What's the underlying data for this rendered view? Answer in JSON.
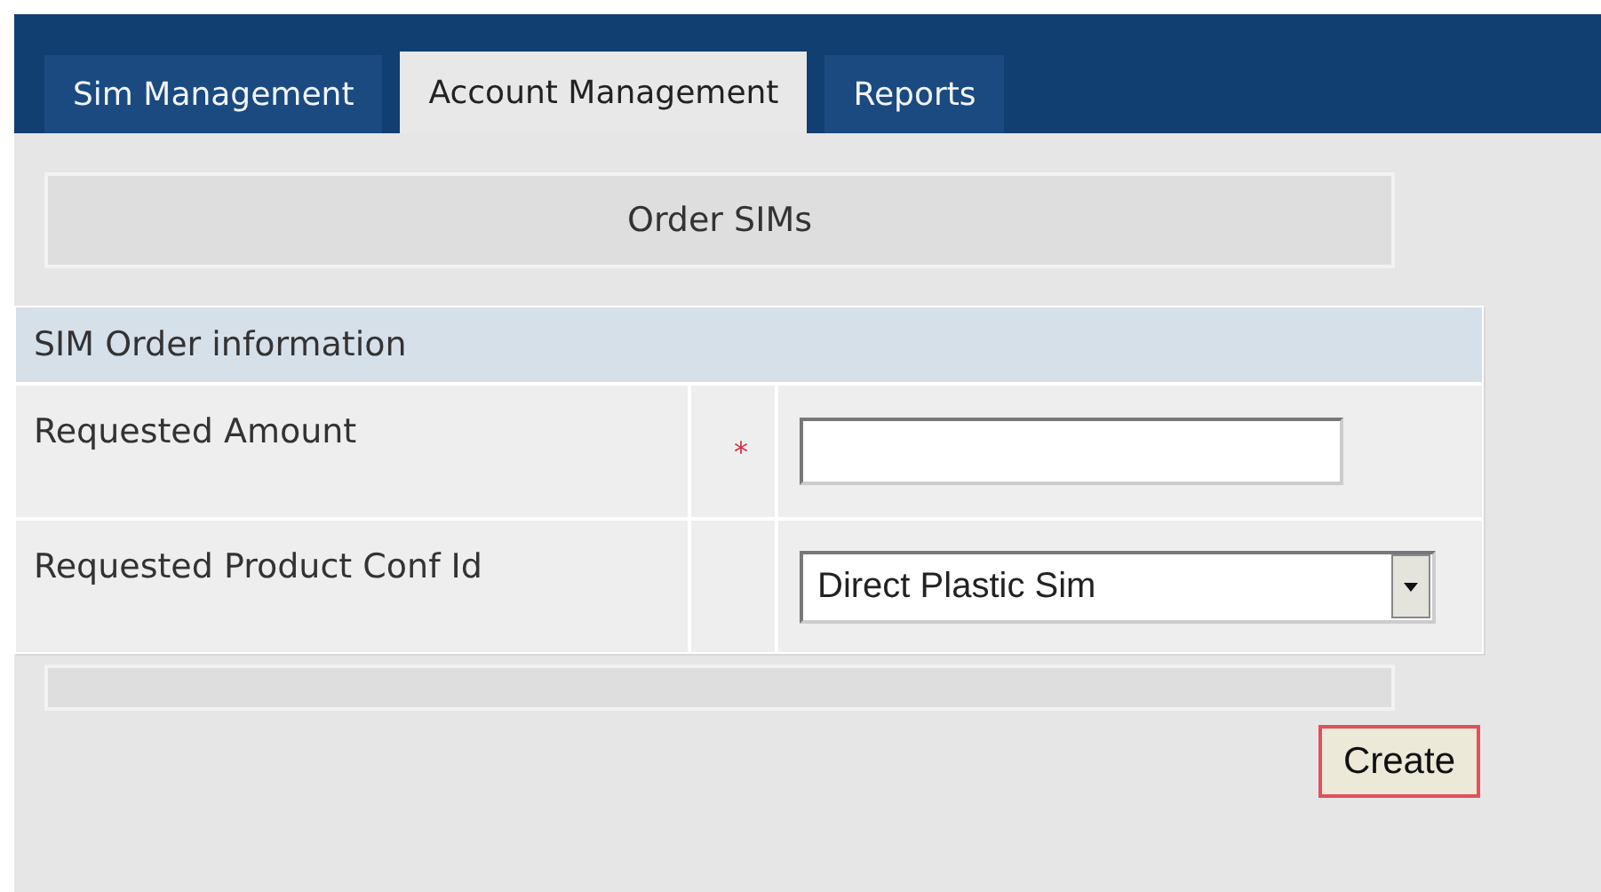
{
  "tabs": [
    {
      "label": "Sim Management",
      "selected": false
    },
    {
      "label": "Account Management",
      "selected": true
    },
    {
      "label": "Reports",
      "selected": false
    }
  ],
  "section_title": "Order SIMs",
  "form": {
    "heading": "SIM Order information",
    "fields": [
      {
        "kind": "text",
        "label": "Requested Amount",
        "required_mark": "*"
      },
      {
        "kind": "select",
        "label": "Requested Product Conf Id",
        "value": "Direct Plastic Sim"
      }
    ]
  },
  "buttons": [
    "Create"
  ]
}
